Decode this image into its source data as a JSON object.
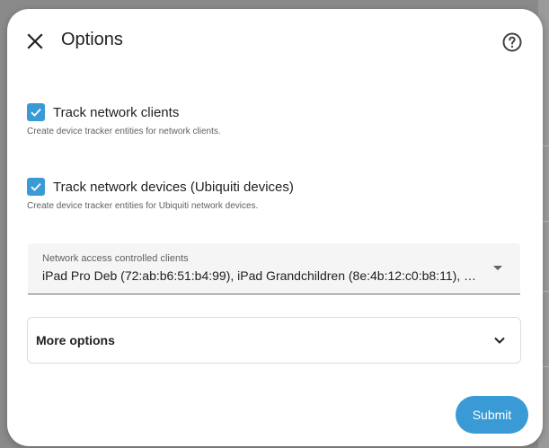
{
  "dialog": {
    "title": "Options"
  },
  "options": [
    {
      "label": "Track network clients",
      "checked": true,
      "helper": "Create device tracker entities for network clients."
    },
    {
      "label": "Track network devices (Ubiquiti devices)",
      "checked": true,
      "helper": "Create device tracker entities for Ubiquiti network devices."
    }
  ],
  "select": {
    "label": "Network access controlled clients",
    "value": "iPad Pro Deb (72:ab:b6:51:b4:99), iPad Grandchildren (8e:4b:12:c0:b8:11), …"
  },
  "more_options": {
    "label": "More options"
  },
  "submit": {
    "label": "Submit"
  },
  "colors": {
    "accent": "#3a9ad6",
    "text": "#212121",
    "secondary_text": "#616161"
  },
  "icons": {
    "close": "close-icon",
    "help": "help-circle-icon",
    "check": "check-icon",
    "dropdown": "arrow-drop-down-icon",
    "chevron": "chevron-down-icon"
  }
}
